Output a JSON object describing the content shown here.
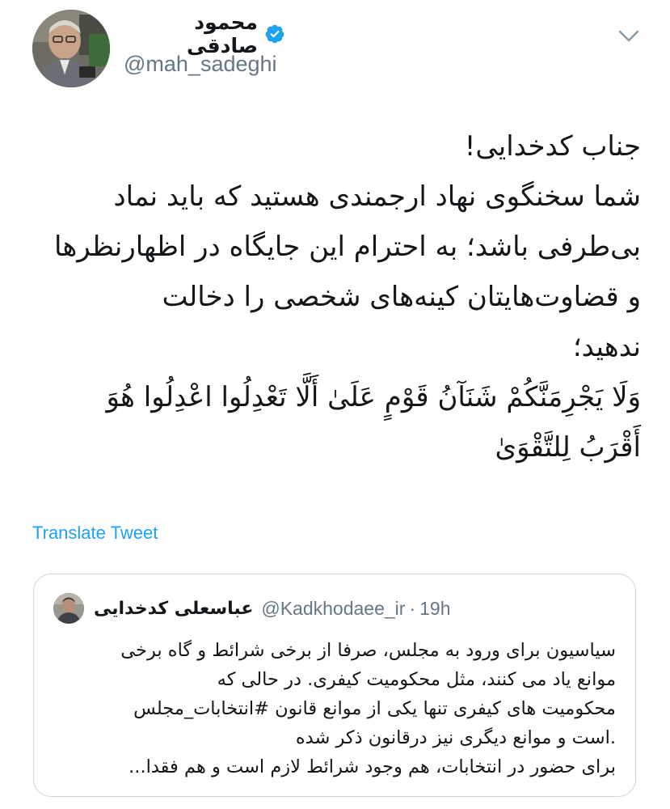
{
  "tweet": {
    "author": {
      "display_name": "محمود صادقی",
      "handle": "@mah_sadeghi",
      "verified": true
    },
    "body_lines": [
      "جناب کدخدایی!",
      "شما سخنگوی نهاد ارجمندی هستید که باید نماد",
      "بی‌طرفی باشد؛ به احترام این جایگاه در اظهارنظرها",
      "و قضاوت‌هایتان کینه‌های شخصی را دخالت",
      "ندهید؛"
    ],
    "verse_lines": [
      "وَلَا يَجْرِمَنَّكُمْ شَنَآنُ قَوْمٍ عَلَىٰ أَلَّا تَعْدِلُوا  اعْدِلُوا هُوَ",
      "أَقْرَبُ لِلتَّقْوَىٰ"
    ],
    "translate_label": "Translate Tweet",
    "menu_icon": "chevron-down-icon"
  },
  "quoted_tweet": {
    "display_name": "عباسعلی کدخدایی",
    "handle": "@Kadkhodaee_ir",
    "separator": "·",
    "time": "19h",
    "body_lines": [
      "سیاسیون برای ورود به مجلس، صرفا از برخی شرائط و گاه برخی",
      "موانع یاد می کنند، مثل محکومیت کیفری. در حالی که",
      "محکومیت های کیفری تنها یکی از موانع قانون #انتخابات_مجلس",
      ".است و موانع دیگری نیز درقانون ذکر شده",
      "برای حضور در انتخابات، هم وجود شرائط لازم است و هم فقدا..."
    ]
  },
  "colors": {
    "text_primary": "#14171a",
    "text_secondary": "#657786",
    "link": "#1da1f2",
    "verified_badge": "#1da1f2",
    "border": "#ccd6dd"
  }
}
